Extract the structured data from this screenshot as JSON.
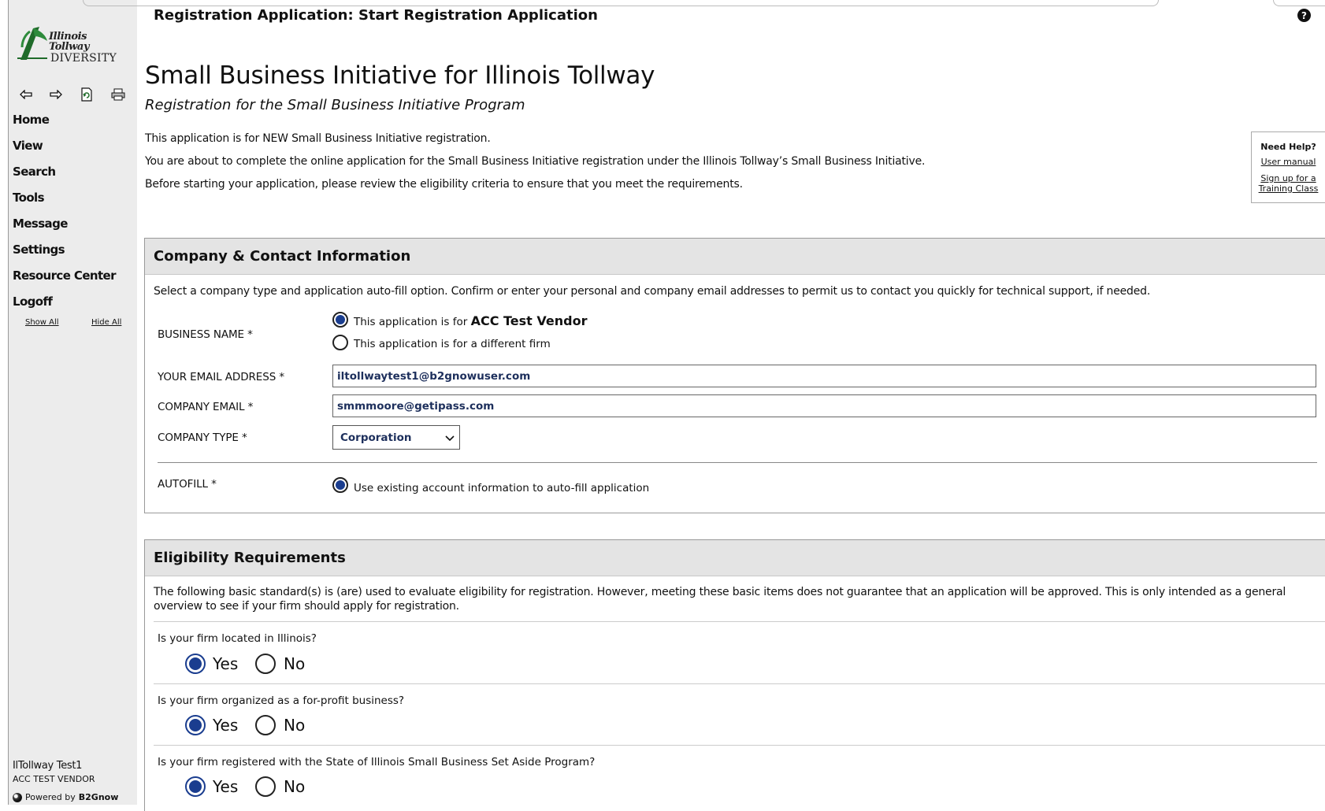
{
  "header": {
    "title": "Registration Application: Start Registration Application",
    "help_icon": "question-circle-icon"
  },
  "sidebar": {
    "logo_line1": "Illinois Tollway",
    "logo_line2": "DIVERSITY",
    "toolbar_icons": [
      "arrow-left-icon",
      "arrow-right-icon",
      "refresh-icon",
      "print-icon"
    ],
    "nav": [
      "Home",
      "View",
      "Search",
      "Tools",
      "Message",
      "Settings",
      "Resource Center",
      "Logoff"
    ],
    "show_all": "Show All",
    "hide_all": "Hide All",
    "user_name": "IlTollway Test1",
    "user_company": "ACC TEST VENDOR",
    "powered_prefix": "Powered by",
    "powered_brand": "B2Gnow"
  },
  "main": {
    "title": "Small Business Initiative for Illinois Tollway",
    "subtitle": "Registration for the Small Business Initiative Program",
    "intro": [
      "This application is for NEW Small Business Initiative registration.",
      "You are about to complete the online application for the Small Business Initiative registration under the Illinois Tollway’s Small Business Initiative.",
      "Before starting your application, please review the eligibility criteria to ensure that you meet the requirements."
    ]
  },
  "need_help": {
    "title": "Need Help?",
    "user_manual": "User manual",
    "training_line1": "Sign up for a",
    "training_line2": "Training Class"
  },
  "company_section": {
    "title": "Company & Contact Information",
    "description": "Select a company type and application auto-fill option. Confirm or enter your personal and company email addresses to permit us to contact you quickly for technical support, if needed.",
    "business_name_label": "BUSINESS NAME *",
    "option_this_prefix": "This application is for",
    "option_this_firm": "ACC Test Vendor",
    "option_other": "This application is for a different firm",
    "business_name_selected": "This application is for ACC Test Vendor",
    "email_label": "YOUR EMAIL ADDRESS *",
    "email_value": "iltollwaytest1@b2gnowuser.com",
    "company_email_label": "COMPANY EMAIL *",
    "company_email_value": "smmmoore@getipass.com",
    "company_type_label": "COMPANY TYPE *",
    "company_type_value": "Corporation",
    "autofill_label": "AUTOFILL *",
    "autofill_option": "Use existing account information to auto-fill application"
  },
  "eligibility_section": {
    "title": "Eligibility Requirements",
    "description": "The following basic standard(s) is (are) used to evaluate eligibility for registration. However, meeting these basic items does not guarantee that an application will be approved. This is only intended as a general overview to see if your firm should apply for registration.",
    "yes_label": "Yes",
    "no_label": "No",
    "questions": [
      {
        "text": "Is your firm located in Illinois?",
        "answer": "Yes"
      },
      {
        "text": "Is your firm organized as a for-profit business?",
        "answer": "Yes"
      },
      {
        "text": "Is your firm registered with the State of Illinois Small Business Set Aside Program?",
        "answer": "Yes"
      }
    ]
  },
  "colors": {
    "sidebar_bg": "#ececec",
    "panel_header_bg": "#e4e4e4",
    "radio_selected": "#1a3d8f",
    "input_text": "#1d2f5c",
    "logo_green": "#1f6b2a"
  }
}
